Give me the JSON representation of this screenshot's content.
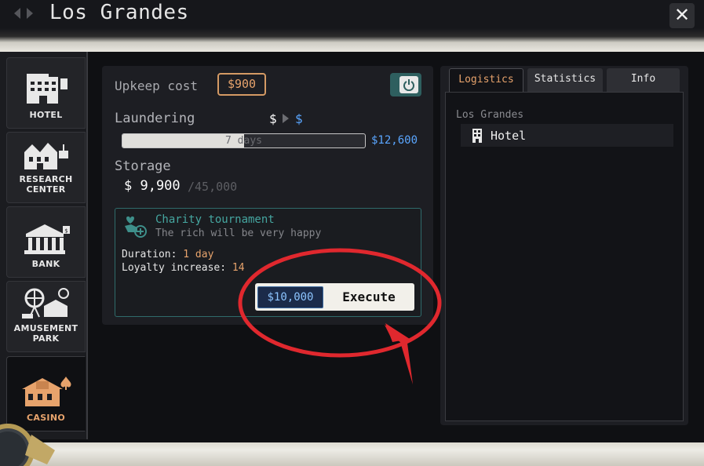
{
  "header": {
    "title": "Los Grandes",
    "prev_icon": "chevron-left-icon",
    "next_icon": "chevron-right-icon",
    "close_label": "✕"
  },
  "sidebar": {
    "items": [
      {
        "label": "HOTEL",
        "icon": "hotel-building-icon",
        "active": false
      },
      {
        "label": "RESEARCH\nCENTER",
        "icon": "research-center-icon",
        "active": false
      },
      {
        "label": "BANK",
        "icon": "bank-icon",
        "active": false
      },
      {
        "label": "AMUSEMENT\nPARK",
        "icon": "amusement-park-icon",
        "active": false
      },
      {
        "label": "CASINO",
        "icon": "casino-icon",
        "active": true
      }
    ]
  },
  "business": {
    "upkeep_label": "Upkeep cost",
    "upkeep_value": "$900",
    "power_on": true,
    "laundering_label": "Laundering",
    "laundering_from": "$",
    "laundering_to": "$",
    "laundering_progress": 0.5,
    "laundering_progress_text": "7 days",
    "laundering_amount": "$12,600",
    "storage_label": "Storage",
    "storage_value": "$ 9,900",
    "storage_capacity": "/45,000"
  },
  "event": {
    "title": "Charity tournament",
    "subtitle": "The rich will be very happy",
    "duration_label": "Duration:",
    "duration_value": "1 day",
    "loyalty_label": "Loyalty increase:",
    "loyalty_value": "14",
    "cost": "$10,000",
    "execute_label": "Execute"
  },
  "right_panel": {
    "tabs": [
      {
        "label": "Logistics",
        "active": true
      },
      {
        "label": "Statistics",
        "active": false
      },
      {
        "label": "Info",
        "active": false
      }
    ],
    "location_header": "Los Grandes",
    "locations": [
      {
        "label": "Hotel",
        "icon": "hotel-building-icon"
      }
    ]
  },
  "colors": {
    "accent_orange": "#e7a36c",
    "money_blue": "#5aa6ff",
    "teal": "#45a6a0",
    "annotation_red": "#e0282e"
  }
}
